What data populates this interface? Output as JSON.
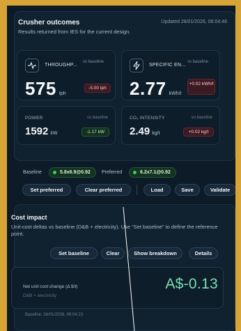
{
  "outcomes": {
    "title": "Crusher outcomes",
    "subtitle": "Results returned from IES for the current design.",
    "updated": "Updated 28/01/2026, 06:04:46",
    "throughput": {
      "label": "THROUGHP...",
      "vs": "vs baseline",
      "value": "575",
      "unit": "tph",
      "delta": "-5.00 tph"
    },
    "specific_energy": {
      "label": "SPECIFIC EN...",
      "vs": "vs baseline",
      "value": "2.77",
      "unit": "kWh/t",
      "delta": "+0.02 kWh/t"
    },
    "power": {
      "label": "POWER",
      "vs": "vs baseline",
      "value": "1592",
      "unit": "kW",
      "delta": "-1.17 kW"
    },
    "co2": {
      "label": "CO₂ INTENSITY",
      "vs": "vs baseline",
      "value": "2.49",
      "unit": "kg/t",
      "delta": "+0.02 kg/t"
    }
  },
  "baseline_row": {
    "baseline_label": "Baseline",
    "baseline_value": "5.8x6.9@0.92",
    "preferred_label": "Preferred",
    "preferred_value": "6.2x7.1@0.92",
    "buttons": {
      "set_preferred": "Set preferred",
      "clear_preferred": "Clear preferred",
      "load": "Load",
      "save": "Save",
      "validate": "Validate"
    }
  },
  "cost": {
    "title": "Cost impact",
    "description": "Unit-cost deltas vs baseline (D&B + electricity). Use “Set baseline” to define the reference point.",
    "buttons": {
      "set_baseline": "Set baseline",
      "clear": "Clear",
      "show_breakdown": "Show breakdown",
      "details": "Details"
    },
    "net_label": "Net unit cost change (Δ $/t)",
    "net_sub": "D&B + electricity",
    "net_value": "A$-0.13",
    "baseline_ts": "Baseline: 28/01/2026, 06:04:23"
  },
  "colors": {
    "accent_gold": "#d7a436",
    "positive_green": "#79e0b0",
    "delta_red": "#3c1a22",
    "delta_green": "#14301f"
  },
  "icons": {
    "throughput": "activity-icon",
    "specific_energy": "lightning-icon"
  }
}
